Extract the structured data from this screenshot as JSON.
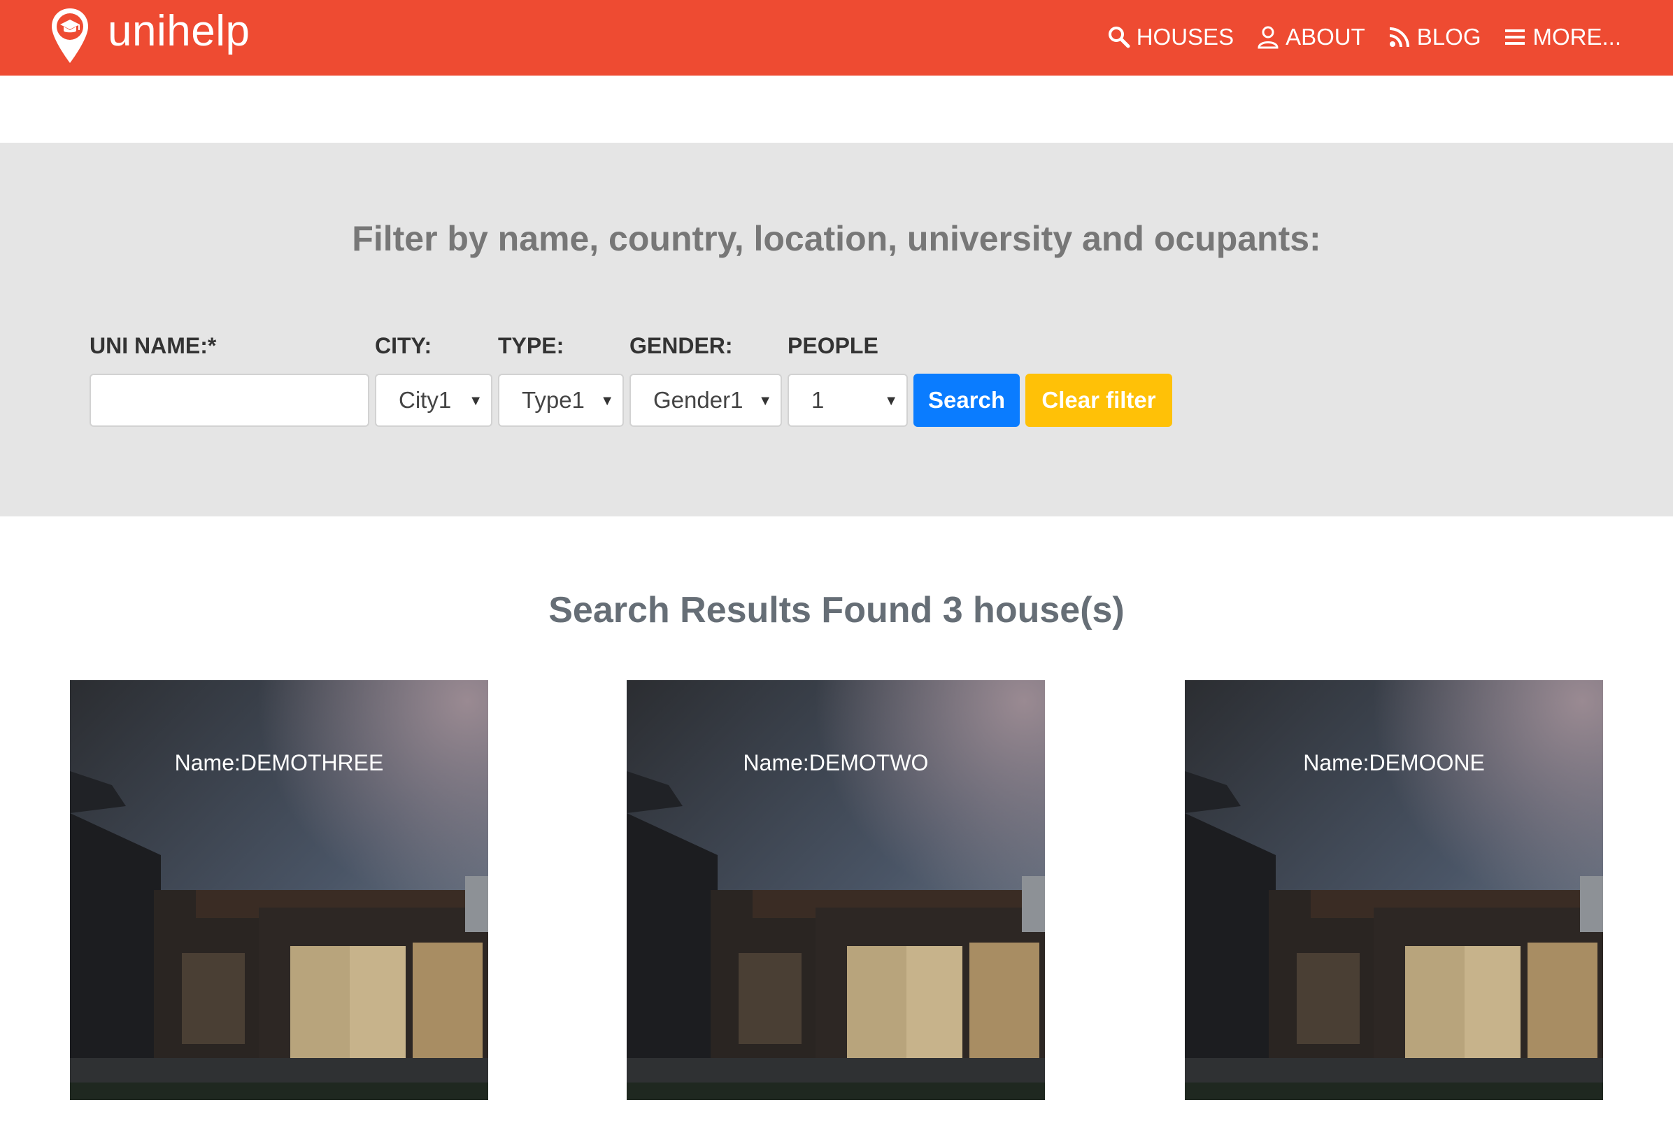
{
  "navbar": {
    "brand": "unihelp",
    "items": [
      {
        "icon": "search-icon",
        "label": "HOUSES"
      },
      {
        "icon": "user-icon",
        "label": "ABOUT"
      },
      {
        "icon": "rss-icon",
        "label": "BLOG"
      },
      {
        "icon": "menu-icon",
        "label": "MORE..."
      }
    ]
  },
  "filter": {
    "title": "Filter by name, country, location, university and ocupants:",
    "uni_name": {
      "label": "UNI NAME:*",
      "value": "",
      "placeholder": ""
    },
    "city": {
      "label": "CITY:",
      "value": "City1"
    },
    "type": {
      "label": "TYPE:",
      "value": "Type1"
    },
    "gender": {
      "label": "GENDER:",
      "value": "Gender1"
    },
    "people": {
      "label": "PEOPLE",
      "value": "1"
    },
    "search_button": "Search",
    "clear_button": "Clear filter"
  },
  "results": {
    "title": "Search Results Found 3 house(s)",
    "houses": [
      {
        "name": "Name:DEMOTHREE"
      },
      {
        "name": "Name:DEMOTWO"
      },
      {
        "name": "Name:DEMOONE"
      }
    ]
  },
  "colors": {
    "navbar": "#ee4b32",
    "filter_background": "#e5e5e5",
    "search_button": "#0a7cff",
    "clear_button": "#ffc107"
  }
}
